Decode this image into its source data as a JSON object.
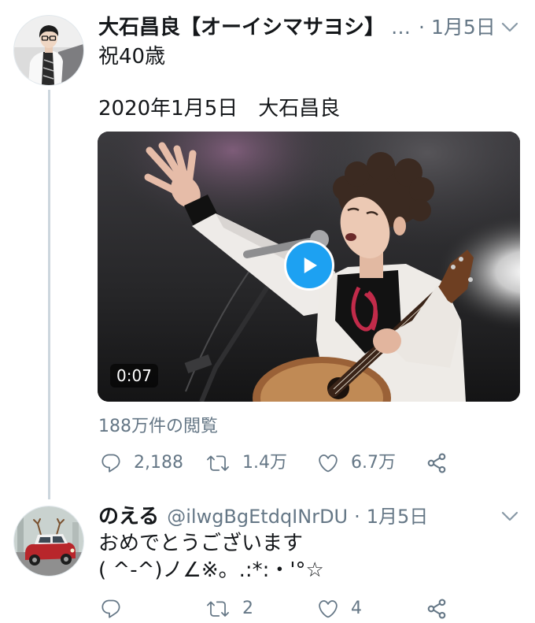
{
  "tweets": [
    {
      "author": {
        "name": "大石昌良【オーイシマサヨシ】",
        "handle": "…"
      },
      "separator": "·",
      "date": "1月5日",
      "text": [
        "祝40歳",
        "2020年1月5日　大石昌良"
      ],
      "media": {
        "duration": "0:07"
      },
      "views": "188万件の閲覧",
      "actions": {
        "replies": "2,188",
        "retweets": "1.4万",
        "likes": "6.7万"
      }
    },
    {
      "author": {
        "name": "のえる",
        "handle": "@ilwgBgEtdqINrDU"
      },
      "separator": "·",
      "date": "1月5日",
      "text": [
        "おめでとうございます",
        "( ^-^)ノ∠※。.:*:・'°☆"
      ],
      "actions": {
        "retweets": "2",
        "likes": "4"
      }
    }
  ],
  "icons": {
    "menu": "chevron-down-icon",
    "play": "play-icon",
    "reply": "reply-icon",
    "retweet": "retweet-icon",
    "like": "heart-icon",
    "share": "share-icon"
  },
  "colors": {
    "text": "#14171A",
    "secondary": "#657786",
    "accent": "#1DA1F2",
    "thread_line": "#CCD6DD",
    "background": "#FFFFFF"
  }
}
